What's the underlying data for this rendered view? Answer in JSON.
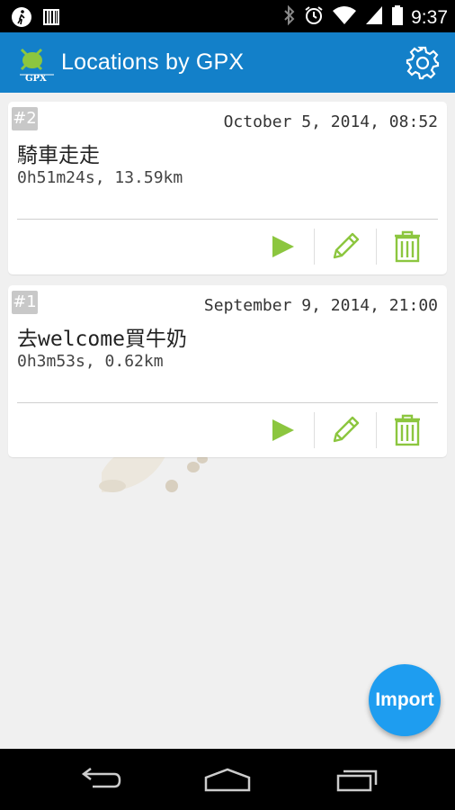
{
  "status_bar": {
    "time": "9:37"
  },
  "action_bar": {
    "title": "Locations by GPX",
    "logo_text": "GPX"
  },
  "tracks": [
    {
      "badge": "#2",
      "date": "October 5, 2014, 08:52",
      "title": "騎車走走",
      "summary": "0h51m24s, 13.59km"
    },
    {
      "badge": "#1",
      "date": "September 9, 2014, 21:00",
      "title": "去welcome買牛奶",
      "summary": "0h3m53s, 0.62km"
    }
  ],
  "fab": {
    "label": "Import"
  },
  "colors": {
    "action_bar": "#1380c9",
    "accent_green": "#8cc63f",
    "fab": "#1e9df0"
  }
}
